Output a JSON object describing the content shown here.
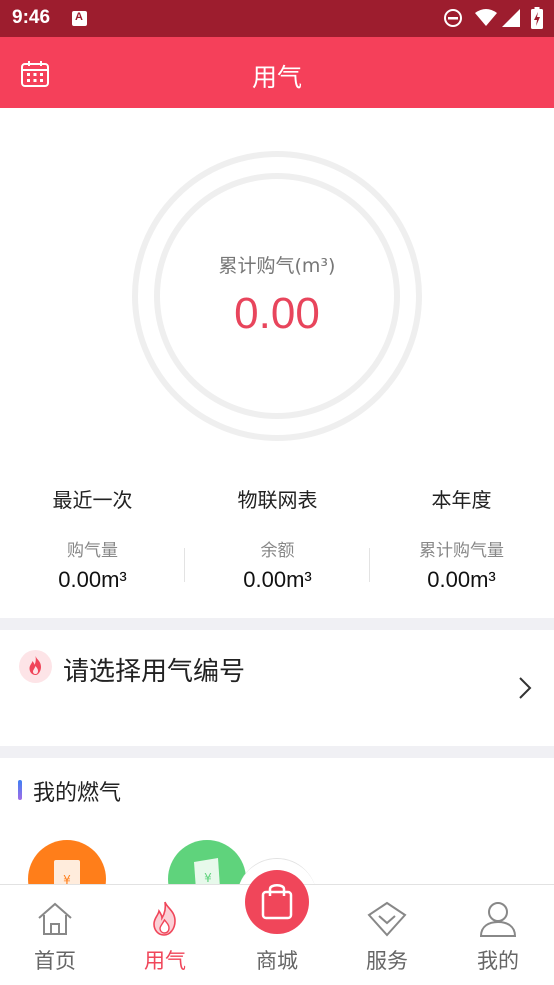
{
  "status_bar": {
    "time": "9:46"
  },
  "header": {
    "title": "用气"
  },
  "summary": {
    "label": "累计购气(m³)",
    "value": "0.00"
  },
  "stats": [
    {
      "title": "最近一次",
      "sub": "购气量",
      "value": "0.00m³"
    },
    {
      "title": "物联网表",
      "sub": "余额",
      "value": "0.00m³"
    },
    {
      "title": "本年度",
      "sub": "累计购气量",
      "value": "0.00m³"
    }
  ],
  "select": {
    "text": "请选择用气编号"
  },
  "my_gas": {
    "title": "我的燃气",
    "icons": [
      "purchase-bill-icon",
      "payment-icon"
    ]
  },
  "tabbar": {
    "items": [
      {
        "label": "首页",
        "icon": "home-icon"
      },
      {
        "label": "用气",
        "icon": "flame-icon",
        "active": true
      },
      {
        "label": "商城",
        "icon": "shopping-bag-icon"
      },
      {
        "label": "服务",
        "icon": "service-icon"
      },
      {
        "label": "我的",
        "icon": "user-icon"
      }
    ]
  },
  "colors": {
    "accent": "#f5405a",
    "status_bar": "#9d1d2e",
    "value_red": "#e8455c"
  }
}
